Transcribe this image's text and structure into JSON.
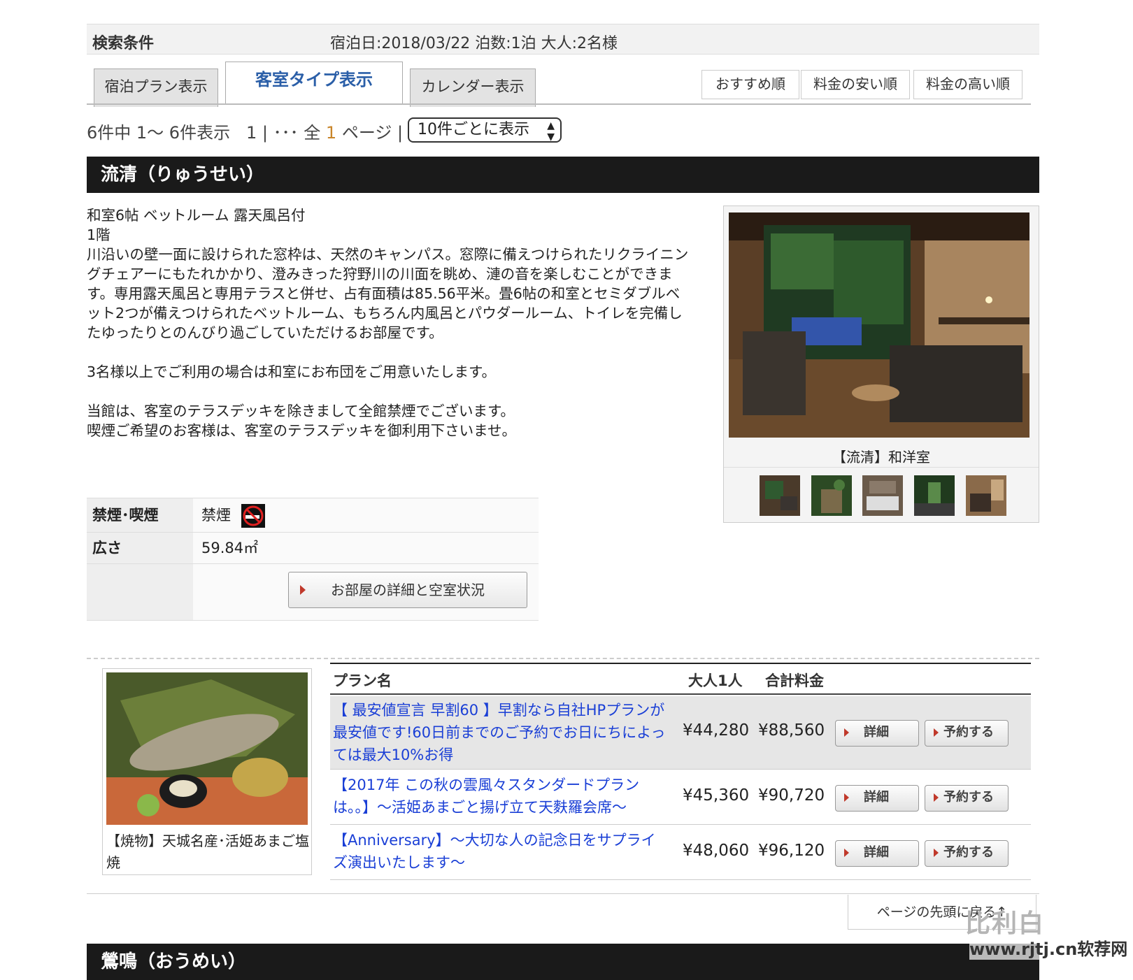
{
  "search": {
    "label": "検索条件",
    "value": "宿泊日:2018/03/22 泊数:1泊 大人:2名様"
  },
  "tabs": [
    {
      "label": "宿泊プラン表示"
    },
    {
      "label": "客室タイプ表示"
    },
    {
      "label": "カレンダー表示"
    }
  ],
  "sort": [
    {
      "label": "おすすめ順"
    },
    {
      "label": "料金の安い順"
    },
    {
      "label": "料金の高い順"
    }
  ],
  "pager": {
    "count_text": "6件中 1～ 6件表示",
    "page_num": "1",
    "sep1": "|",
    "dots": "･･･ 全",
    "total": "1",
    "pages_word": "ページ",
    "sep2": "|",
    "per_page": "10件ごとに表示"
  },
  "room1": {
    "title": "流清（りゅうせい）",
    "desc": {
      "line1": "和室6帖 ベットルーム 露天風呂付",
      "line2": "1階",
      "line3": "川沿いの壁一面に設けられた窓枠は、天然のキャンパス。窓際に備えつけられたリクライニン",
      "line4": "グチェアーにもたれかかり、澄みきった狩野川の川面を眺め、漣の音を楽しむことができま",
      "line5": "す。専用露天風呂と専用テラスと併せ、占有面積は85.56平米。畳6帖の和室とセミダブルベ",
      "line6": "ット2つが備えつけられたベットルーム、もちろん内風呂とパウダールーム、トイレを完備し",
      "line7": "たゆったりとのんびり過ごしていただけるお部屋です。",
      "line8": "3名様以上でご利用の場合は和室にお布団をご用意いたします。",
      "line9": "当館は、客室のテラスデッキを除きまして全館禁煙でございます。",
      "line10": "喫煙ご希望のお客様は、客室のテラスデッキを御利用下さいませ。"
    },
    "info": {
      "smoking_label": "禁煙･喫煙",
      "smoking_value": "禁煙",
      "area_label": "広さ",
      "area_value": "59.84㎡",
      "detail_button": "お部屋の詳細と空室状況"
    },
    "photo_caption": "【流清】和洋室",
    "food_caption": "【焼物】天城名産･活姫あまご塩焼",
    "plan_header": {
      "name": "プラン名",
      "adult": "大人1人",
      "total": "合計料金"
    },
    "plans": [
      {
        "name": "【 最安値宣言 早割60 】早割なら自社HPプランが最安値です!60日前までのご予約でお日にちによっては最大10%お得",
        "adult_price": "¥44,280",
        "total_price": "¥88,560",
        "detail": "詳細",
        "reserve": "予約する"
      },
      {
        "name": "【2017年 この秋の雲風々スタンダードプランは。。】～活姫あまごと揚げ立て天麩羅会席～",
        "adult_price": "¥45,360",
        "total_price": "¥90,720",
        "detail": "詳細",
        "reserve": "予約する"
      },
      {
        "name": "【Anniversary】～大切な人の記念日をサプライズ演出いたします～",
        "adult_price": "¥48,060",
        "total_price": "¥96,120",
        "detail": "詳細",
        "reserve": "予約する"
      }
    ]
  },
  "page_top": "ページの先頭に戻る↑",
  "room2": {
    "title": "鶯鳴（おうめい）"
  },
  "watermark": {
    "logo": "比利白",
    "url": "www.rjtj.cn软荐网"
  }
}
